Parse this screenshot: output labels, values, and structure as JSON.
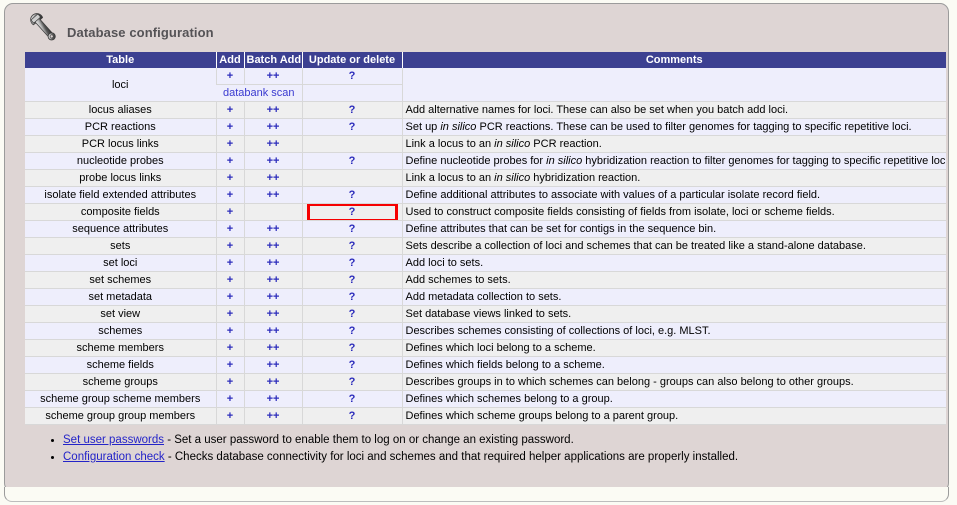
{
  "panel": {
    "title": "Database configuration",
    "icon": "wrench-icon"
  },
  "colors": {
    "header_bg": "#3c4091",
    "panel_bg": "#ded5d4",
    "row_odd": "#eeeefc",
    "row_even": "#efefef",
    "link": "#2b2bbb",
    "highlight": "#f60000"
  },
  "table": {
    "columns": [
      "Table",
      "Add",
      "Batch Add",
      "Update or delete",
      "Comments"
    ],
    "scan_label": "databank scan",
    "add_symbol": "+",
    "batch_symbol": "++",
    "update_symbol": "?",
    "rows": [
      {
        "table": "loci",
        "add": "+",
        "batch": "++",
        "update": "?",
        "comment": "",
        "has_scan": true
      },
      {
        "table": "locus aliases",
        "add": "+",
        "batch": "++",
        "update": "?",
        "comment": "Add alternative names for loci. These can also be set when you batch add loci."
      },
      {
        "table": "PCR reactions",
        "add": "+",
        "batch": "++",
        "update": "?",
        "comment_pre": "Set up ",
        "comment_italic": "in silico",
        "comment_post": " PCR reactions. These can be used to filter genomes for tagging to specific repetitive loci."
      },
      {
        "table": "PCR locus links",
        "add": "+",
        "batch": "++",
        "update": "",
        "comment_pre": "Link a locus to an ",
        "comment_italic": "in silico",
        "comment_post": " PCR reaction."
      },
      {
        "table": "nucleotide probes",
        "add": "+",
        "batch": "++",
        "update": "?",
        "comment_pre": "Define nucleotide probes for ",
        "comment_italic": "in silico",
        "comment_post": " hybridization reaction to filter genomes for tagging to specific repetitive loci."
      },
      {
        "table": "probe locus links",
        "add": "+",
        "batch": "++",
        "update": "",
        "comment_pre": "Link a locus to an ",
        "comment_italic": "in silico",
        "comment_post": " hybridization reaction."
      },
      {
        "table": "isolate field extended attributes",
        "add": "+",
        "batch": "++",
        "update": "?",
        "comment": "Define additional attributes to associate with values of a particular isolate record field."
      },
      {
        "table": "composite fields",
        "add": "+",
        "batch": "",
        "update": "?",
        "comment": "Used to construct composite fields consisting of fields from isolate, loci or scheme fields.",
        "highlighted": true
      },
      {
        "table": "sequence attributes",
        "add": "+",
        "batch": "++",
        "update": "?",
        "comment": "Define attributes that can be set for contigs in the sequence bin."
      },
      {
        "table": "sets",
        "add": "+",
        "batch": "++",
        "update": "?",
        "comment": "Sets describe a collection of loci and schemes that can be treated like a stand-alone database."
      },
      {
        "table": "set loci",
        "add": "+",
        "batch": "++",
        "update": "?",
        "comment": "Add loci to sets."
      },
      {
        "table": "set schemes",
        "add": "+",
        "batch": "++",
        "update": "?",
        "comment": "Add schemes to sets."
      },
      {
        "table": "set metadata",
        "add": "+",
        "batch": "++",
        "update": "?",
        "comment": "Add metadata collection to sets."
      },
      {
        "table": "set view",
        "add": "+",
        "batch": "++",
        "update": "?",
        "comment": "Set database views linked to sets."
      },
      {
        "table": "schemes",
        "add": "+",
        "batch": "++",
        "update": "?",
        "comment": "Describes schemes consisting of collections of loci, e.g. MLST."
      },
      {
        "table": "scheme members",
        "add": "+",
        "batch": "++",
        "update": "?",
        "comment": "Defines which loci belong to a scheme."
      },
      {
        "table": "scheme fields",
        "add": "+",
        "batch": "++",
        "update": "?",
        "comment": "Defines which fields belong to a scheme."
      },
      {
        "table": "scheme groups",
        "add": "+",
        "batch": "++",
        "update": "?",
        "comment": "Describes groups in to which schemes can belong - groups can also belong to other groups."
      },
      {
        "table": "scheme group scheme members",
        "add": "+",
        "batch": "++",
        "update": "?",
        "comment": "Defines which schemes belong to a group."
      },
      {
        "table": "scheme group group members",
        "add": "+",
        "batch": "++",
        "update": "?",
        "comment": "Defines which scheme groups belong to a parent group."
      }
    ]
  },
  "notes": [
    {
      "link": "Set user passwords",
      "text": " - Set a user password to enable them to log on or change an existing password."
    },
    {
      "link": "Configuration check",
      "text": " - Checks database connectivity for loci and schemes and that required helper applications are properly installed."
    }
  ]
}
